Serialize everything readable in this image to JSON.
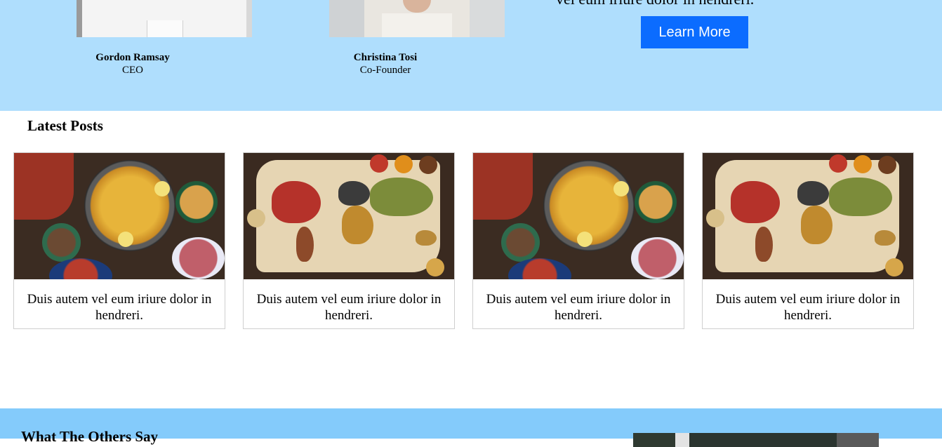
{
  "team": {
    "members": [
      {
        "name": "Gordon Ramsay",
        "role": "CEO"
      },
      {
        "name": "Christina Tosi",
        "role": "Co-Founder"
      }
    ],
    "cut_text": "vel eum iriure dolor in hendreri.",
    "learn_more_label": "Learn More",
    "colors": {
      "section_bg": "#afdefd",
      "button_bg": "#0b6cff"
    }
  },
  "latest_posts": {
    "title": "Latest Posts",
    "posts": [
      {
        "image": "paella-image",
        "caption": "Duis autem vel eum iriure dolor in hendreri."
      },
      {
        "image": "spice-world-map-image",
        "caption": "Duis autem vel eum iriure dolor in hendreri."
      },
      {
        "image": "paella-image",
        "caption": "Duis autem vel eum iriure dolor in hendreri."
      },
      {
        "image": "spice-world-map-image",
        "caption": "Duis autem vel eum iriure dolor in hendreri."
      }
    ]
  },
  "testimonials": {
    "title": "What The Others Say",
    "colors": {
      "section_bg": "#84cbfb"
    }
  }
}
